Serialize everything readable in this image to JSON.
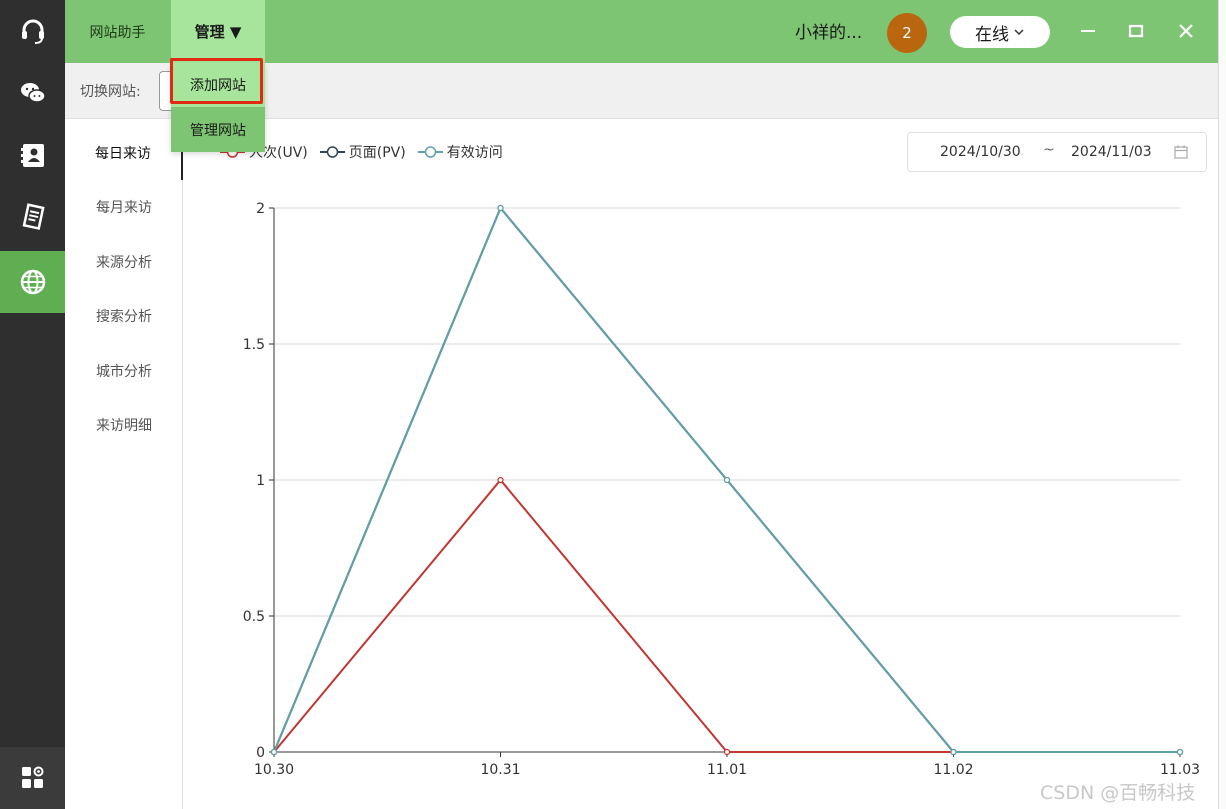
{
  "topbar": {
    "tab_helper": "网站助手",
    "tab_manage": "管理 ▼",
    "user_name": "小祥的...",
    "badge_count": "2",
    "status": "在线",
    "bar_color": "#7dc473",
    "active_tab_color": "#a6e59b"
  },
  "rail": {
    "items": [
      {
        "icon": "headset-icon"
      },
      {
        "icon": "wechat-icon"
      },
      {
        "icon": "contacts-icon"
      },
      {
        "icon": "notes-icon"
      },
      {
        "icon": "globe-icon",
        "active": true
      },
      {
        "icon": "apps-icon"
      }
    ],
    "active_color": "#5fae52"
  },
  "toolbar": {
    "switch_label": "切换网站:"
  },
  "dropdown": {
    "items": [
      "添加网站",
      "管理网站"
    ],
    "highlight_color": "#e02a14"
  },
  "subnav": {
    "items": [
      "每日来访",
      "每月来访",
      "来源分析",
      "搜索分析",
      "城市分析",
      "来访明细"
    ],
    "active_index": 0
  },
  "date_range": {
    "start": "2024/10/30",
    "separator": "~",
    "end": "2024/11/03"
  },
  "chart_data": {
    "type": "line",
    "categories": [
      "10.30",
      "10.31",
      "11.01",
      "11.02",
      "11.03"
    ],
    "ylim": [
      0,
      2
    ],
    "yticks": [
      "0",
      "0.5",
      "1",
      "1.5",
      "2"
    ],
    "grid": true,
    "legend_position": "top-left",
    "series": [
      {
        "name": "人次(UV)",
        "color": "#c23531",
        "values": [
          0,
          1,
          0,
          0,
          0
        ]
      },
      {
        "name": "页面(PV)",
        "color": "#2f4554",
        "values": [
          0,
          2,
          1,
          0,
          0
        ]
      },
      {
        "name": "有效访问",
        "color": "#61a0a8",
        "values": [
          0,
          2,
          1,
          0,
          0
        ]
      }
    ]
  },
  "watermark": "CSDN @百畅科技"
}
